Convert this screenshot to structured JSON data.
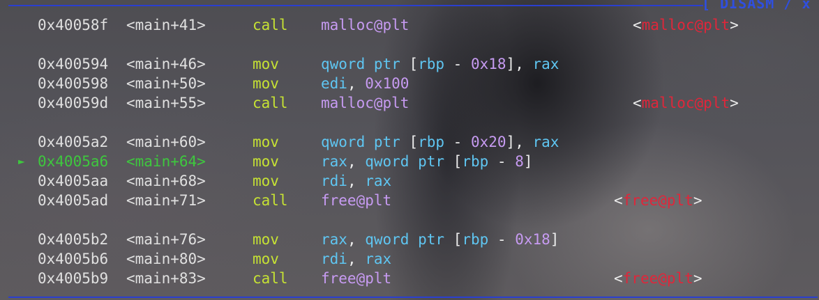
{
  "header": {
    "title": "[ DISASM / x"
  },
  "rows": [
    {
      "addr": "0x40058f",
      "sym": "<main+41>",
      "mnem": "call",
      "ops": [
        [
          "malloc@plt",
          "c-func"
        ]
      ],
      "ann": "malloc@plt",
      "current": false
    },
    {
      "addr": "0x400594",
      "sym": "<main+46>",
      "mnem": "mov",
      "ops": [
        [
          "qword ptr",
          "c-kw"
        ],
        [
          " [",
          "c-punc"
        ],
        [
          "rbp",
          "c-reg"
        ],
        [
          " - ",
          "c-punc"
        ],
        [
          "0x18",
          "c-num"
        ],
        [
          "], ",
          "c-punc"
        ],
        [
          "rax",
          "c-reg"
        ]
      ],
      "ann": "",
      "current": false
    },
    {
      "addr": "0x400598",
      "sym": "<main+50>",
      "mnem": "mov",
      "ops": [
        [
          "edi",
          "c-reg"
        ],
        [
          ", ",
          "c-punc"
        ],
        [
          "0x100",
          "c-num"
        ]
      ],
      "ann": "",
      "current": false
    },
    {
      "addr": "0x40059d",
      "sym": "<main+55>",
      "mnem": "call",
      "ops": [
        [
          "malloc@plt",
          "c-func"
        ]
      ],
      "ann": "malloc@plt",
      "current": false
    },
    {
      "addr": "0x4005a2",
      "sym": "<main+60>",
      "mnem": "mov",
      "ops": [
        [
          "qword ptr",
          "c-kw"
        ],
        [
          " [",
          "c-punc"
        ],
        [
          "rbp",
          "c-reg"
        ],
        [
          " - ",
          "c-punc"
        ],
        [
          "0x20",
          "c-num"
        ],
        [
          "], ",
          "c-punc"
        ],
        [
          "rax",
          "c-reg"
        ]
      ],
      "ann": "",
      "current": false
    },
    {
      "addr": "0x4005a6",
      "sym": "<main+64>",
      "mnem": "mov",
      "ops": [
        [
          "rax",
          "c-reg"
        ],
        [
          ", ",
          "c-punc"
        ],
        [
          "qword ptr",
          "c-kw"
        ],
        [
          " [",
          "c-punc"
        ],
        [
          "rbp",
          "c-reg"
        ],
        [
          " - ",
          "c-punc"
        ],
        [
          "8",
          "c-num"
        ],
        [
          "]",
          "c-punc"
        ]
      ],
      "ann": "",
      "current": true
    },
    {
      "addr": "0x4005aa",
      "sym": "<main+68>",
      "mnem": "mov",
      "ops": [
        [
          "rdi",
          "c-reg"
        ],
        [
          ", ",
          "c-punc"
        ],
        [
          "rax",
          "c-reg"
        ]
      ],
      "ann": "",
      "current": false
    },
    {
      "addr": "0x4005ad",
      "sym": "<main+71>",
      "mnem": "call",
      "ops": [
        [
          "free@plt",
          "c-func"
        ]
      ],
      "ann": "free@plt",
      "current": false
    },
    {
      "addr": "0x4005b2",
      "sym": "<main+76>",
      "mnem": "mov",
      "ops": [
        [
          "rax",
          "c-reg"
        ],
        [
          ", ",
          "c-punc"
        ],
        [
          "qword ptr",
          "c-kw"
        ],
        [
          " [",
          "c-punc"
        ],
        [
          "rbp",
          "c-reg"
        ],
        [
          " - ",
          "c-punc"
        ],
        [
          "0x18",
          "c-num"
        ],
        [
          "]",
          "c-punc"
        ]
      ],
      "ann": "",
      "current": false
    },
    {
      "addr": "0x4005b6",
      "sym": "<main+80>",
      "mnem": "mov",
      "ops": [
        [
          "rdi",
          "c-reg"
        ],
        [
          ", ",
          "c-punc"
        ],
        [
          "rax",
          "c-reg"
        ]
      ],
      "ann": "",
      "current": false
    },
    {
      "addr": "0x4005b9",
      "sym": "<main+83>",
      "mnem": "call",
      "ops": [
        [
          "free@plt",
          "c-func"
        ]
      ],
      "ann": "free@plt",
      "current": false
    }
  ],
  "current_marker": "►",
  "colors": {
    "rule": "#2a3fd0",
    "current": "#3ec83e",
    "mnemonic": "#c6e234",
    "register": "#5fc6f2",
    "number": "#c79bf2",
    "external": "#e0263a"
  }
}
